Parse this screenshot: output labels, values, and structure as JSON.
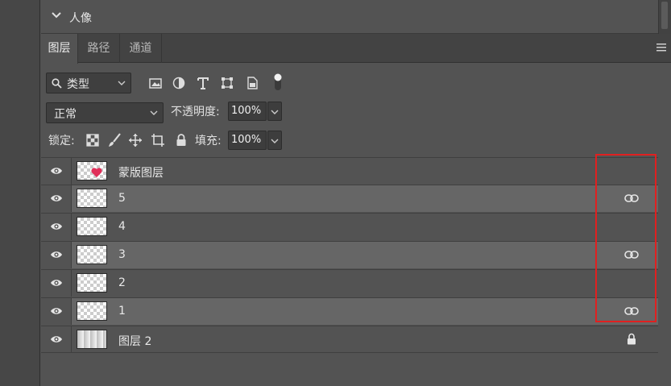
{
  "collapsed_panel": {
    "title": "人像"
  },
  "tabs": [
    {
      "label": "图层",
      "active": true
    },
    {
      "label": "路径",
      "active": false
    },
    {
      "label": "通道",
      "active": false
    }
  ],
  "filter": {
    "kind_label": "类型"
  },
  "blend": {
    "mode": "正常",
    "opacity_label": "不透明度:",
    "opacity_value": "100%"
  },
  "lock_row": {
    "lock_label": "锁定:",
    "fill_label": "填充:",
    "fill_value": "100%"
  },
  "layers": [
    {
      "name": "蒙版图层",
      "thumb": "heart",
      "linked": false,
      "locked": false,
      "highlight": false
    },
    {
      "name": "5",
      "thumb": "transparent",
      "linked": true,
      "locked": false,
      "highlight": true
    },
    {
      "name": "4",
      "thumb": "transparent",
      "linked": false,
      "locked": false,
      "highlight": false
    },
    {
      "name": "3",
      "thumb": "transparent",
      "linked": true,
      "locked": false,
      "highlight": true
    },
    {
      "name": "2",
      "thumb": "transparent",
      "linked": false,
      "locked": false,
      "highlight": false
    },
    {
      "name": "1",
      "thumb": "transparent",
      "linked": true,
      "locked": false,
      "highlight": true
    },
    {
      "name": "图层 2",
      "thumb": "gradient",
      "linked": false,
      "locked": true,
      "highlight": false
    }
  ],
  "colors": {
    "annotation_box": "#e02020",
    "highlight_row": "#666666",
    "normal_row": "#535353"
  }
}
